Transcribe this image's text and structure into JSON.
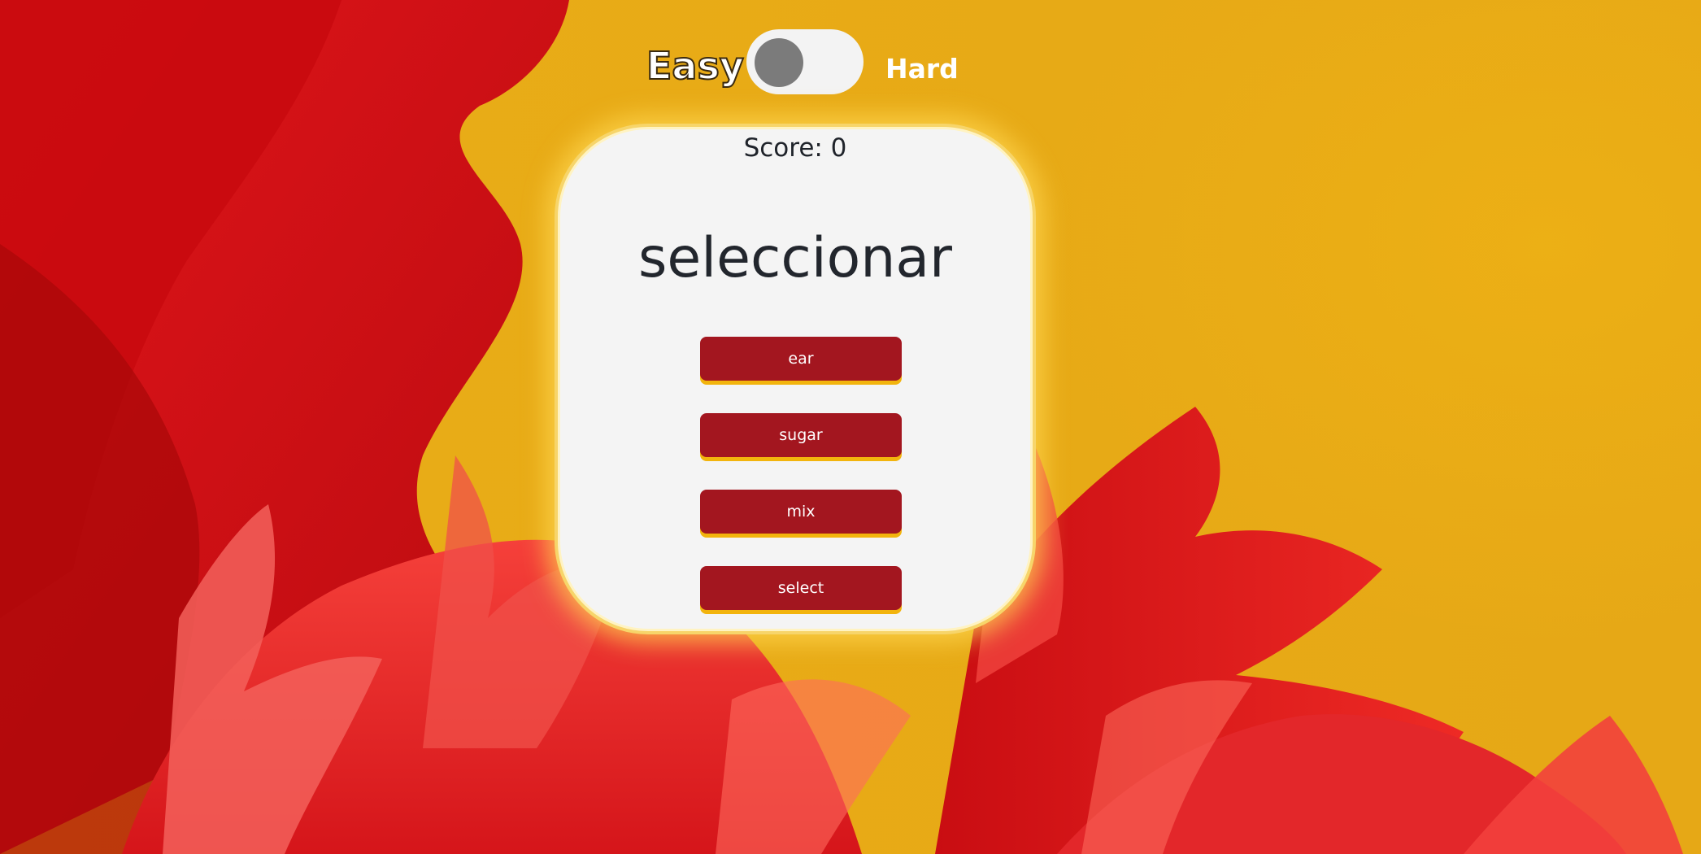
{
  "difficulty": {
    "easy_label": "Easy",
    "hard_label": "Hard",
    "mode": "easy"
  },
  "game": {
    "score_label": "Score: 0",
    "word": "seleccionar",
    "choices": [
      "ear",
      "sugar",
      "mix",
      "select"
    ]
  },
  "colors": {
    "button": "#a3161f",
    "button_shadow": "#f2b40d",
    "card": "#f4f4f4",
    "card_border": "#f7d56a",
    "background_yellow": "#e6ab14",
    "background_red": "#d90c10"
  }
}
